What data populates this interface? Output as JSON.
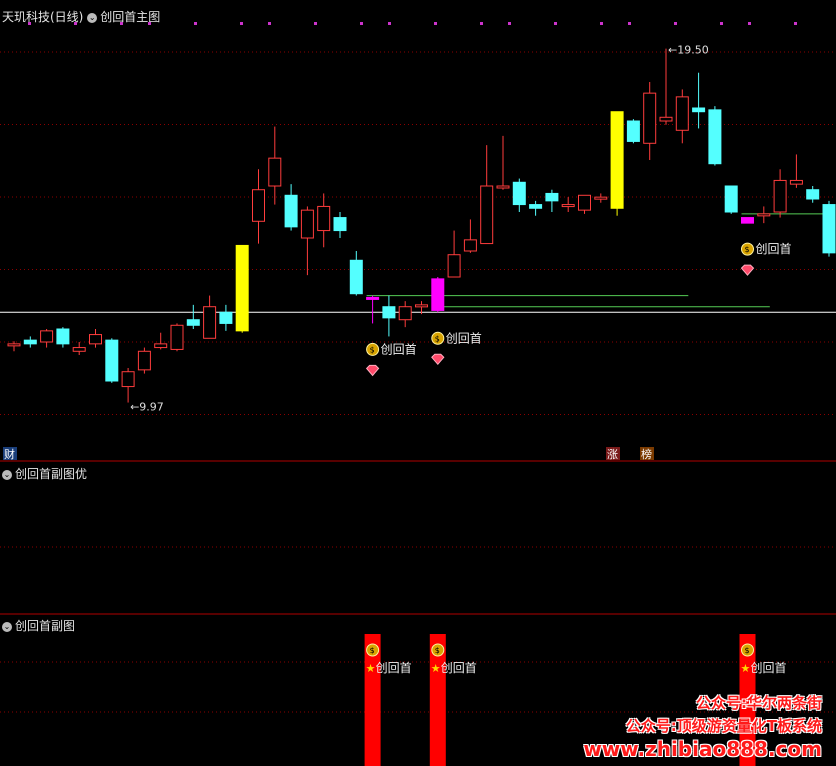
{
  "header": {
    "stock": "天玑科技(日线)",
    "main_panel": "创回首主图"
  },
  "panels": {
    "sub1_title": "创回首副图优",
    "sub2_title": "创回首副图"
  },
  "badges": {
    "cai": "财",
    "zhang": "涨",
    "bang": "榜"
  },
  "signal_label": "创回首",
  "watermark": {
    "line1": "公众号:华尔两条街",
    "line2": "公众号:顶级游资量化T板系统",
    "line3": "www.zhibiao888.com"
  },
  "colors": {
    "up": "#ff3d3d",
    "down": "#54ffff",
    "yellow": "#ffff00",
    "magenta": "#ff00ff",
    "ma": "#ffffff",
    "grid": "#8b0000",
    "support": "#55cc55",
    "bar": "#ff0000"
  },
  "chart_data": {
    "type": "candlestick",
    "title": "创回首主图",
    "y_range": [
      8.8,
      20.0
    ],
    "max_label": "19.50",
    "min_label": "9.97",
    "candles": [
      {
        "o": 11.5,
        "c": 11.55,
        "h": 11.62,
        "l": 11.35,
        "color": "up"
      },
      {
        "o": 11.65,
        "c": 11.55,
        "h": 11.75,
        "l": 11.45,
        "color": "down"
      },
      {
        "o": 11.6,
        "c": 11.9,
        "h": 11.95,
        "l": 11.45,
        "color": "up"
      },
      {
        "o": 11.95,
        "c": 11.55,
        "h": 12.0,
        "l": 11.45,
        "color": "down"
      },
      {
        "o": 11.35,
        "c": 11.45,
        "h": 11.6,
        "l": 11.25,
        "color": "up"
      },
      {
        "o": 11.55,
        "c": 11.8,
        "h": 11.95,
        "l": 11.45,
        "color": "up"
      },
      {
        "o": 11.65,
        "c": 10.55,
        "h": 11.7,
        "l": 10.5,
        "color": "down"
      },
      {
        "o": 10.4,
        "c": 10.8,
        "h": 10.9,
        "l": 9.97,
        "color": "up"
      },
      {
        "o": 10.85,
        "c": 11.35,
        "h": 11.45,
        "l": 10.75,
        "color": "up"
      },
      {
        "o": 11.45,
        "c": 11.55,
        "h": 11.85,
        "l": 11.4,
        "color": "up"
      },
      {
        "o": 11.4,
        "c": 12.05,
        "h": 12.1,
        "l": 11.35,
        "color": "up"
      },
      {
        "o": 12.2,
        "c": 12.05,
        "h": 12.6,
        "l": 11.95,
        "color": "down"
      },
      {
        "o": 11.7,
        "c": 12.55,
        "h": 12.85,
        "l": 11.7,
        "color": "up"
      },
      {
        "o": 12.1,
        "c": 12.4,
        "h": 12.6,
        "l": 11.9,
        "color": "down"
      },
      {
        "o": 11.9,
        "c": 14.2,
        "h": 14.2,
        "l": 11.85,
        "color": "yellow"
      },
      {
        "o": 14.85,
        "c": 15.7,
        "h": 16.25,
        "l": 14.25,
        "color": "up"
      },
      {
        "o": 15.8,
        "c": 16.55,
        "h": 17.4,
        "l": 15.3,
        "color": "up"
      },
      {
        "o": 15.55,
        "c": 14.7,
        "h": 15.85,
        "l": 14.6,
        "color": "down"
      },
      {
        "o": 14.4,
        "c": 15.15,
        "h": 15.25,
        "l": 13.4,
        "color": "up"
      },
      {
        "o": 14.6,
        "c": 15.25,
        "h": 15.6,
        "l": 14.15,
        "color": "up"
      },
      {
        "o": 14.95,
        "c": 14.6,
        "h": 15.1,
        "l": 14.4,
        "color": "down"
      },
      {
        "o": 13.8,
        "c": 12.9,
        "h": 14.05,
        "l": 12.85,
        "color": "down"
      },
      {
        "o": 12.75,
        "c": 12.8,
        "h": 12.85,
        "l": 12.1,
        "color": "magenta"
      },
      {
        "o": 12.55,
        "c": 12.25,
        "h": 12.85,
        "l": 11.75,
        "color": "down"
      },
      {
        "o": 12.2,
        "c": 12.55,
        "h": 12.7,
        "l": 12.0,
        "color": "up"
      },
      {
        "o": 12.55,
        "c": 12.6,
        "h": 12.7,
        "l": 12.35,
        "color": "up"
      },
      {
        "o": 12.45,
        "c": 13.3,
        "h": 13.35,
        "l": 12.4,
        "color": "magenta"
      },
      {
        "o": 13.35,
        "c": 13.95,
        "h": 14.6,
        "l": 13.35,
        "color": "up"
      },
      {
        "o": 14.05,
        "c": 14.35,
        "h": 14.9,
        "l": 14.0,
        "color": "up"
      },
      {
        "o": 14.25,
        "c": 15.8,
        "h": 16.9,
        "l": 14.25,
        "color": "up"
      },
      {
        "o": 15.8,
        "c": 15.8,
        "h": 17.15,
        "l": 15.7,
        "color": "up"
      },
      {
        "o": 15.9,
        "c": 15.3,
        "h": 16.0,
        "l": 15.1,
        "color": "down"
      },
      {
        "o": 15.3,
        "c": 15.2,
        "h": 15.4,
        "l": 15.0,
        "color": "down"
      },
      {
        "o": 15.6,
        "c": 15.4,
        "h": 15.7,
        "l": 15.1,
        "color": "down"
      },
      {
        "o": 15.25,
        "c": 15.3,
        "h": 15.5,
        "l": 15.1,
        "color": "up"
      },
      {
        "o": 15.15,
        "c": 15.55,
        "h": 15.55,
        "l": 15.05,
        "color": "up"
      },
      {
        "o": 15.5,
        "c": 15.45,
        "h": 15.6,
        "l": 15.35,
        "color": "up"
      },
      {
        "o": 15.2,
        "c": 17.8,
        "h": 17.8,
        "l": 15.0,
        "color": "yellow"
      },
      {
        "o": 17.55,
        "c": 17.0,
        "h": 17.6,
        "l": 16.95,
        "color": "down"
      },
      {
        "o": 16.95,
        "c": 18.3,
        "h": 18.6,
        "l": 16.5,
        "color": "up"
      },
      {
        "o": 17.55,
        "c": 17.65,
        "h": 19.5,
        "l": 17.45,
        "color": "up"
      },
      {
        "o": 17.3,
        "c": 18.2,
        "h": 18.4,
        "l": 16.95,
        "color": "up"
      },
      {
        "o": 17.9,
        "c": 17.8,
        "h": 18.85,
        "l": 17.35,
        "color": "down"
      },
      {
        "o": 17.85,
        "c": 16.4,
        "h": 17.95,
        "l": 16.35,
        "color": "down"
      },
      {
        "o": 15.8,
        "c": 15.1,
        "h": 15.8,
        "l": 15.05,
        "color": "down"
      },
      {
        "o": 14.95,
        "c": 14.8,
        "h": 14.95,
        "l": 14.8,
        "color": "magenta"
      },
      {
        "o": 15.0,
        "c": 15.05,
        "h": 15.25,
        "l": 14.8,
        "color": "up"
      },
      {
        "o": 15.1,
        "c": 15.95,
        "h": 16.25,
        "l": 14.95,
        "color": "up"
      },
      {
        "o": 15.85,
        "c": 15.95,
        "h": 16.65,
        "l": 15.75,
        "color": "up"
      },
      {
        "o": 15.7,
        "c": 15.45,
        "h": 15.8,
        "l": 15.35,
        "color": "down"
      },
      {
        "o": 15.3,
        "c": 14.0,
        "h": 15.4,
        "l": 13.9,
        "color": "down"
      }
    ],
    "support_lines": [
      {
        "value": 12.85,
        "from": 22,
        "to": 41
      },
      {
        "value": 12.55,
        "from": 26,
        "to": 46
      },
      {
        "value": 15.05,
        "from": 45,
        "to": 50
      }
    ],
    "ma_level": 12.4,
    "signal_candles": [
      22,
      26,
      45
    ],
    "sub_bars": [
      22,
      26,
      45
    ]
  }
}
